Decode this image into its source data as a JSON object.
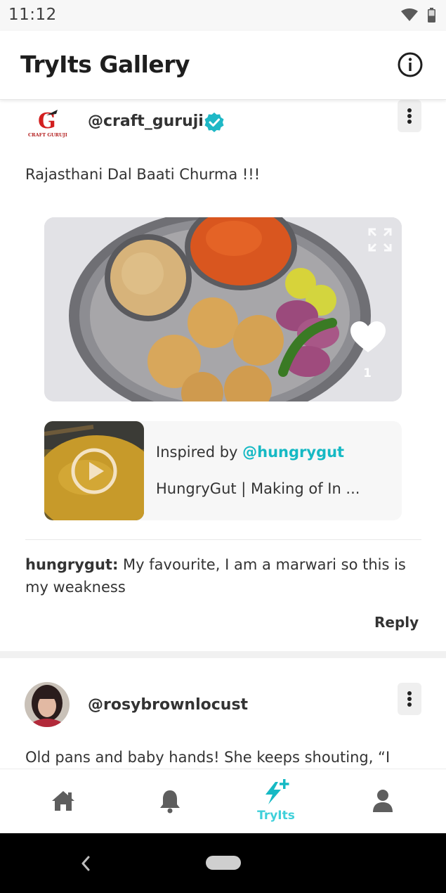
{
  "status_bar": {
    "time": "11:12"
  },
  "header": {
    "title": "TryIts Gallery",
    "info_icon": "info-icon"
  },
  "posts": [
    {
      "avatar_logo_text": {
        "letter": "G",
        "line": "CRAFT GURUJI"
      },
      "username": "@craft_guruji",
      "verified": true,
      "caption": "Rajasthani Dal Baati Churma !!!",
      "likes": "1",
      "inspired": {
        "prefix": "Inspired by ",
        "handle": "@hungrygut",
        "video_title": "HungryGut | Making of In ..."
      },
      "comment": {
        "user": "hungrygut:",
        "text": " My favourite, I am a marwari so this is my weakness",
        "reply_label": "Reply"
      }
    },
    {
      "username": "@rosybrownlocust",
      "caption": "Old pans and baby hands! She keeps shouting, “I"
    }
  ],
  "bottom_nav": {
    "items": [
      {
        "icon": "home-icon",
        "label": ""
      },
      {
        "icon": "bell-icon",
        "label": ""
      },
      {
        "icon": "tryits-bolt-icon",
        "label": "TryIts",
        "active": true
      },
      {
        "icon": "profile-icon",
        "label": ""
      }
    ]
  },
  "colors": {
    "accent": "#16b9c4",
    "accent_light": "#3fd0da",
    "verified": "#1fb8c6"
  }
}
